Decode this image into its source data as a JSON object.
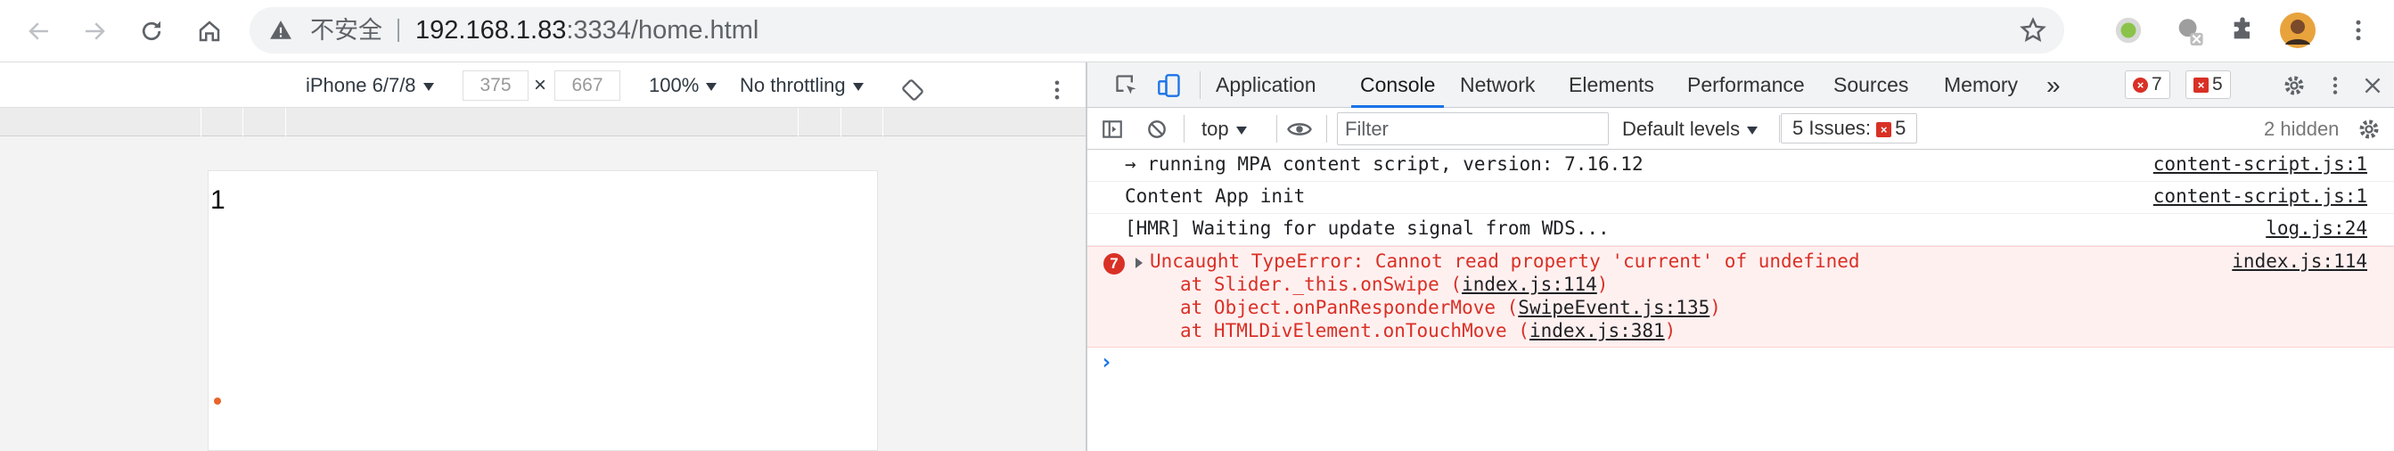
{
  "browser": {
    "security_label": "不安全",
    "url_host": "192.168.1.83",
    "url_rest": ":3334/home.html"
  },
  "device_toolbar": {
    "device": "iPhone 6/7/8",
    "width": "375",
    "times": "×",
    "height": "667",
    "zoom": "100%",
    "throttling": "No throttling"
  },
  "page": {
    "content_text": "1"
  },
  "devtools": {
    "tabs": [
      {
        "label": "Application"
      },
      {
        "label": "Console"
      },
      {
        "label": "Network"
      },
      {
        "label": "Elements"
      },
      {
        "label": "Performance"
      },
      {
        "label": "Sources"
      },
      {
        "label": "Memory"
      }
    ],
    "more_tabs": "»",
    "errors_count": "7",
    "issues_count": "5",
    "toolbar": {
      "context": "top",
      "filter_placeholder": "Filter",
      "levels": "Default levels",
      "issues_label": "5 Issues:",
      "issues_badge": "5",
      "hidden": "2 hidden"
    },
    "console": {
      "rows": [
        {
          "message": "→ running MPA content script, version: 7.16.12",
          "source": "content-script.js:1"
        },
        {
          "message": "Content App init",
          "source": "content-script.js:1"
        },
        {
          "message": "[HMR] Waiting for update signal from WDS...",
          "source": "log.js:24"
        }
      ],
      "error": {
        "count": "7",
        "message": "Uncaught TypeError: Cannot read property 'current' of undefined",
        "source": "index.js:114",
        "stack": [
          {
            "prefix": "at Slider._this.onSwipe (",
            "link": "index.js:114",
            "suffix": ")"
          },
          {
            "prefix": "at Object.onPanResponderMove (",
            "link": "SwipeEvent.js:135",
            "suffix": ")"
          },
          {
            "prefix": "at HTMLDivElement.onTouchMove (",
            "link": "index.js:381",
            "suffix": ")"
          }
        ]
      },
      "prompt": "›"
    }
  },
  "colors": {
    "accent": "#1a73e8",
    "error": "#d93025",
    "error_bg": "#fff0f0"
  },
  "icons": [
    "back-icon",
    "forward-icon",
    "reload-icon",
    "home-icon",
    "warning-icon",
    "star-icon",
    "extension-icon",
    "avatar",
    "menu-icon",
    "inspect-icon",
    "device-toggle-icon",
    "rotate-icon",
    "sidebar-icon",
    "clear-icon",
    "eye-icon",
    "settings-icon",
    "close-icon"
  ]
}
